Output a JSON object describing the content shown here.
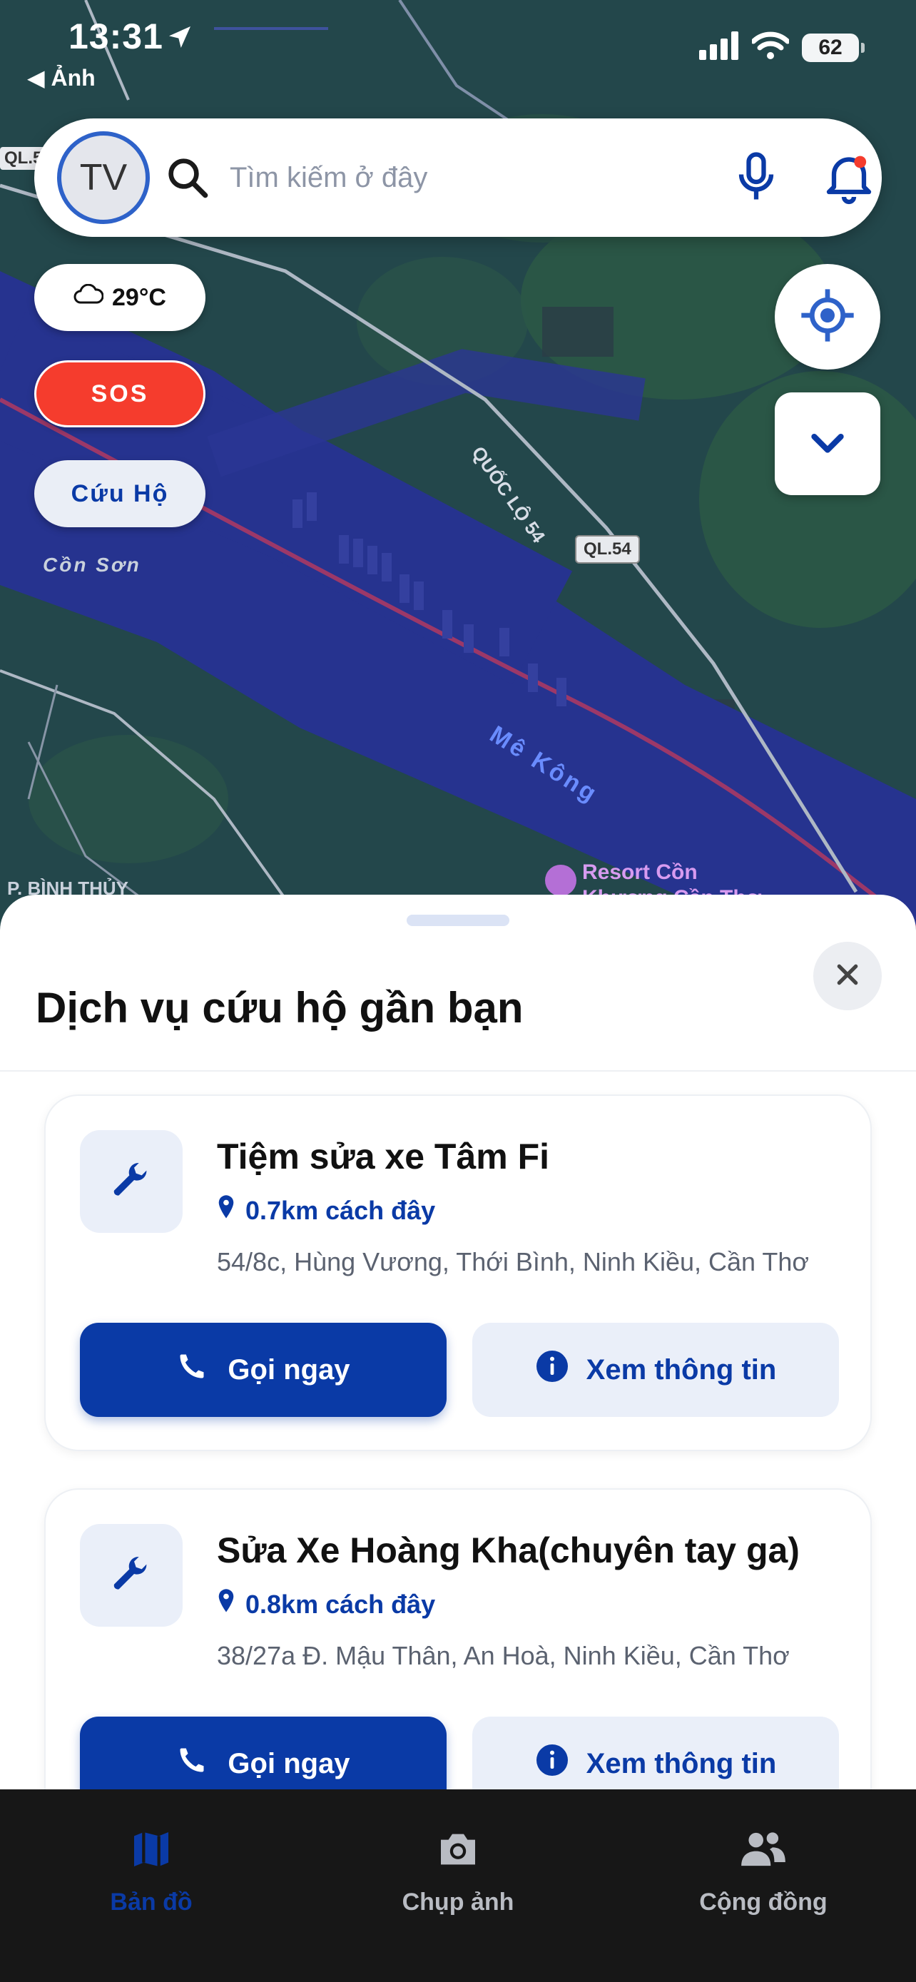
{
  "status_bar": {
    "time": "13:31",
    "back_label": "◀ Ảnh",
    "battery": "62"
  },
  "search": {
    "avatar_initials": "TV",
    "placeholder": "Tìm kiếm ở đây"
  },
  "chips": {
    "weather": "29°C",
    "sos": "SOS",
    "rescue": "Cứu Hộ"
  },
  "map_labels": {
    "ql5": "QL.5",
    "quoc_lo": "QUỐC LỘ 54",
    "ql54": "QL.54",
    "con_son": "Cồn Sơn",
    "mekong": "Mê Kông",
    "binh_thuy": "P. BÌNH THỦY",
    "resort_line1": "Resort Cồn",
    "resort_line2": "Khương Cần Thơ"
  },
  "sheet": {
    "title": "Dịch vụ cứu hộ gần bạn",
    "call_label": "Gọi ngay",
    "info_label": "Xem thông tin",
    "items": [
      {
        "name": "Tiệm sửa xe Tâm Fi",
        "distance": "0.7km cách đây",
        "address": "54/8c, Hùng Vương, Thới Bình, Ninh Kiều, Cần Thơ"
      },
      {
        "name": "Sửa Xe Hoàng Kha(chuyên tay ga)",
        "distance": "0.8km cách đây",
        "address": "38/27a Đ. Mậu Thân, An Hoà, Ninh Kiều, Cần Thơ"
      }
    ]
  },
  "tabbar": {
    "items": [
      {
        "label": "Bản đồ"
      },
      {
        "label": "Chụp ảnh"
      },
      {
        "label": "Cộng đồng"
      }
    ]
  },
  "colors": {
    "primary": "#0a3aa6",
    "sos": "#f53c2d",
    "river": "#26338f",
    "land": "#24494a"
  },
  "icons": [
    "location-arrow-icon",
    "signal-icon",
    "wifi-icon",
    "search-icon",
    "mic-icon",
    "bell-icon",
    "cloud-icon",
    "crosshair-icon",
    "chevron-down-icon",
    "close-icon",
    "wrench-icon",
    "pin-icon",
    "phone-icon",
    "info-icon",
    "map-icon",
    "camera-icon",
    "users-icon"
  ]
}
